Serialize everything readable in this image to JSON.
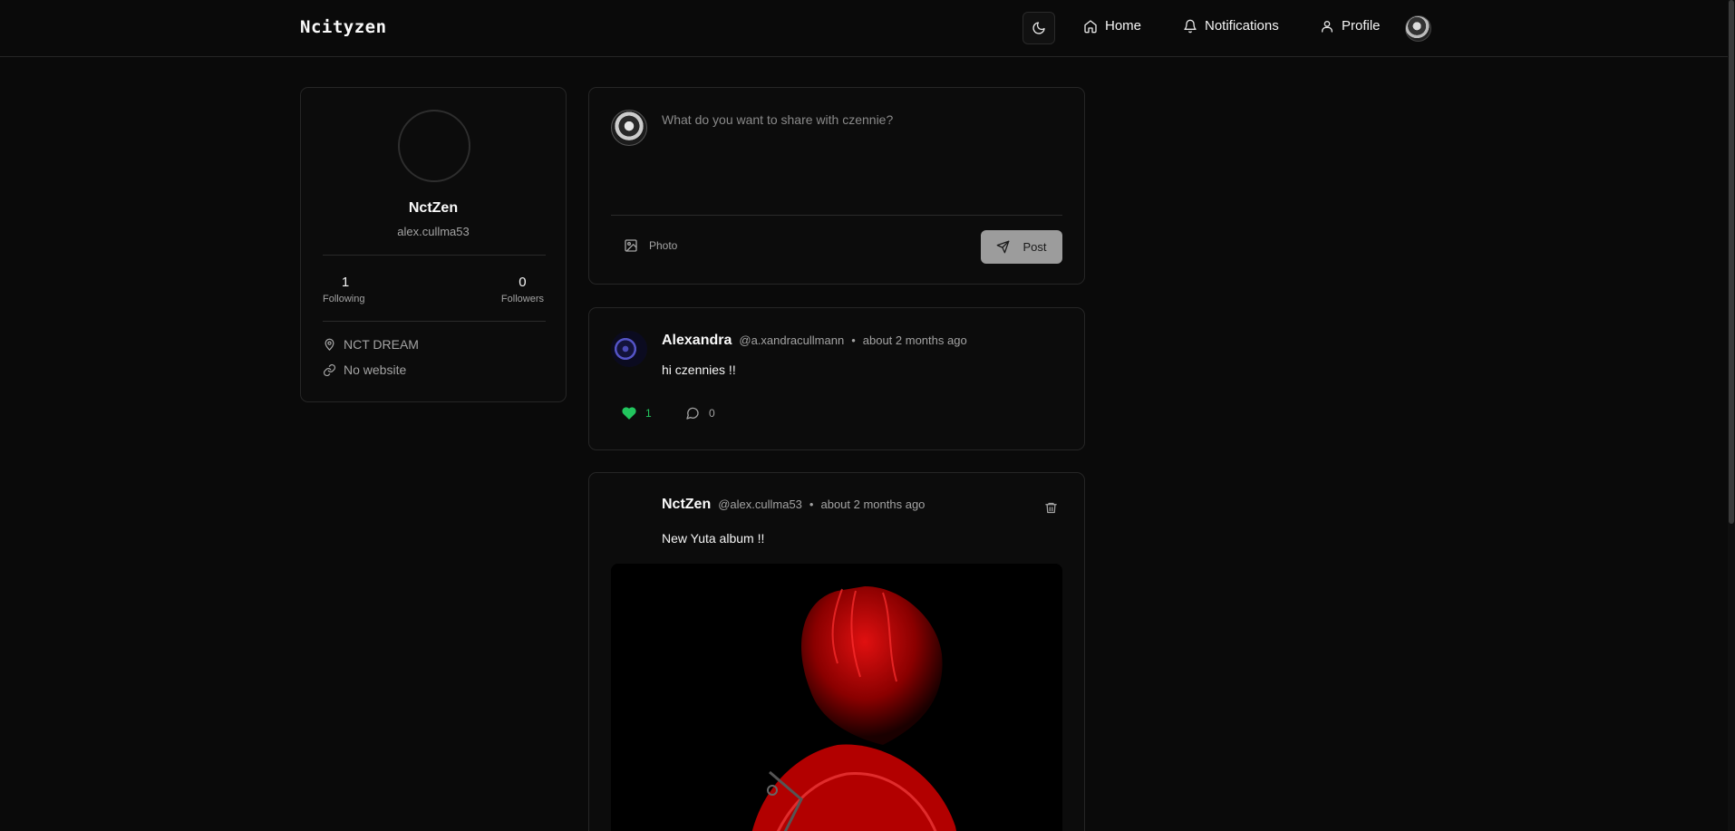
{
  "app": {
    "brand": "Ncityzen"
  },
  "nav": {
    "home_label": "Home",
    "notifications_label": "Notifications",
    "profile_label": "Profile"
  },
  "profile": {
    "name": "NctZen",
    "handle": "alex.cullma53",
    "following_count": "1",
    "following_label": "Following",
    "followers_count": "0",
    "followers_label": "Followers",
    "location": "NCT DREAM",
    "website": "No website"
  },
  "compose": {
    "placeholder": "What do you want to share with czennie?",
    "photo_label": "Photo",
    "post_label": "Post"
  },
  "posts": [
    {
      "author": "Alexandra",
      "handle": "@a.xandracullmann",
      "separator": "•",
      "time": "about 2 months ago",
      "text": "hi czennies !!",
      "likes": "1",
      "comments": "0"
    },
    {
      "author": "NctZen",
      "handle": "@alex.cullma53",
      "separator": "•",
      "time": "about 2 months ago",
      "text": "New Yuta album !!"
    }
  ],
  "colors": {
    "background": "#0a0a0a",
    "card_border": "#262626",
    "like_green": "#22c55e",
    "post_button": "#9c9c9c",
    "image_red": "#c00000"
  },
  "icons": {
    "theme": "moon-icon",
    "home": "home-icon",
    "notifications": "bell-icon",
    "profile": "user-icon",
    "photo": "image-icon",
    "post": "send-icon",
    "location": "map-pin-icon",
    "website": "link-icon",
    "like": "heart-icon",
    "comment": "message-circle-icon",
    "delete": "trash-icon"
  }
}
